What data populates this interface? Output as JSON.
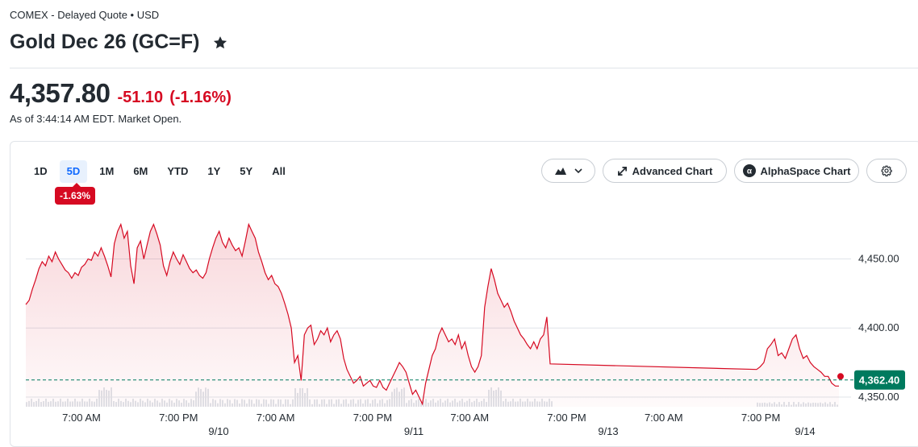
{
  "header": {
    "exchange": "COMEX - Delayed Quote • USD",
    "title": "Gold Dec 26 (GC=F)",
    "star_icon": "star-icon"
  },
  "quote": {
    "price": "4,357.80",
    "change": "-51.10",
    "change_percent": "(-1.16%)",
    "as_of": "As of 3:44:14 AM EDT. Market Open.",
    "color_down": "#d60a22"
  },
  "chart_controls": {
    "ranges": [
      "1D",
      "5D",
      "1M",
      "6M",
      "YTD",
      "1Y",
      "5Y",
      "All"
    ],
    "active_range": "5D",
    "range_change_badge": "-1.63%",
    "chart_type_icon": "mountain-chart-icon",
    "advanced_chart_label": "Advanced Chart",
    "alphaspace_chart_label": "AlphaSpace Chart",
    "settings_icon": "gear-icon"
  },
  "chart_data": {
    "type": "area",
    "title": "",
    "xlabel": "",
    "ylabel": "",
    "y_ticks": [
      "4,450.00",
      "4,400.00",
      "4,350.00"
    ],
    "y_tick_values": [
      4450,
      4400,
      4350
    ],
    "ylim": [
      4343,
      4480
    ],
    "x_time_labels": [
      "7:00 AM",
      "7:00 PM",
      "7:00 AM",
      "7:00 PM",
      "7:00 AM",
      "7:00 PM",
      "7:00 AM",
      "7:00 PM"
    ],
    "x_date_labels": [
      "9/10",
      "9/11",
      "9/13",
      "9/14"
    ],
    "last_price_label": "4,362.40",
    "last_price": 4362.4,
    "line_color": "#d60a22",
    "last_price_color": "#007a5e",
    "grid": true,
    "series": [
      {
        "values": [
          4417,
          4420,
          4428,
          4435,
          4443,
          4448,
          4445,
          4452,
          4448,
          4455,
          4450,
          4446,
          4442,
          4440,
          4436,
          4440,
          4438,
          4444,
          4446,
          4450,
          4449,
          4455,
          4452,
          4458,
          4452,
          4445,
          4437,
          4461,
          4470,
          4475,
          4465,
          4470,
          4445,
          4432,
          4458,
          4463,
          4450,
          4460,
          4470,
          4475,
          4468,
          4460,
          4445,
          4438,
          4448,
          4455,
          4450,
          4446,
          4453,
          4448,
          4443,
          4440,
          4442,
          4438,
          4436,
          4440,
          4450,
          4458,
          4465,
          4470,
          4462,
          4458,
          4465,
          4460,
          4456,
          4458,
          4452,
          4463,
          4475,
          4470,
          4465,
          4455,
          4448,
          4440,
          4435,
          4438,
          4432,
          4430,
          4425,
          4418,
          4410,
          4400,
          4375,
          4380,
          4362,
          4395,
          4400,
          4402,
          4388,
          4392,
          4398,
          4395,
          4400,
          4390,
          4395,
          4398,
          4392,
          4378,
          4370,
          4365,
          4360,
          4362,
          4365,
          4358,
          4360,
          4362,
          4358,
          4357,
          4362,
          4357,
          4355,
          4360,
          4365,
          4370,
          4375,
          4372,
          4368,
          4360,
          4352,
          4355,
          4350,
          4345,
          4360,
          4370,
          4380,
          4385,
          4395,
          4400,
          4395,
          4390,
          4392,
          4388,
          4395,
          4385,
          4390,
          4380,
          4372,
          4368,
          4372,
          4380,
          4415,
          4430,
          4443,
          4435,
          4425,
          4420,
          4415,
          4418,
          4412,
          4405,
          4400,
          4395,
          4392,
          4388,
          4385,
          4390,
          4385,
          4392,
          4395,
          4408,
          4374,
          4370,
          4372,
          4375,
          4385,
          4388,
          4392,
          4380,
          4382,
          4378,
          4385,
          4392,
          4395,
          4385,
          4378,
          4380,
          4375,
          4372,
          4370,
          4368,
          4365,
          4365,
          4360,
          4358,
          4358
        ]
      }
    ]
  }
}
